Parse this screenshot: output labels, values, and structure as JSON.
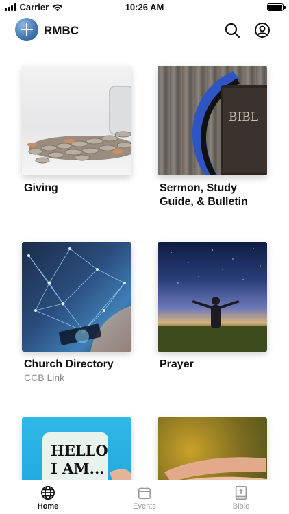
{
  "status_bar": {
    "carrier": "Carrier",
    "time": "10:26 AM"
  },
  "header": {
    "title": "RMBC",
    "logo_icon": "church-cross-logo",
    "search_icon": "search-icon",
    "profile_icon": "user-circle-icon"
  },
  "cards": [
    {
      "title": "Giving",
      "subtitle": ""
    },
    {
      "title": "Sermon, Study Guide, & Bulletin",
      "subtitle": ""
    },
    {
      "title": "Church Directory",
      "subtitle": "CCB Link"
    },
    {
      "title": "Prayer",
      "subtitle": ""
    },
    {
      "title": "",
      "subtitle": "",
      "image_text": "HELLO I AM... NEW"
    },
    {
      "title": "",
      "subtitle": ""
    }
  ],
  "tabs": [
    {
      "label": "Home",
      "icon": "globe-icon",
      "active": true
    },
    {
      "label": "Events",
      "icon": "calendar-icon",
      "active": false
    },
    {
      "label": "Bible",
      "icon": "bible-icon",
      "active": false
    }
  ],
  "colors": {
    "active_tab": "#111111",
    "inactive_tab": "#9a9a9a",
    "logo_blue": "#3f74b0"
  }
}
